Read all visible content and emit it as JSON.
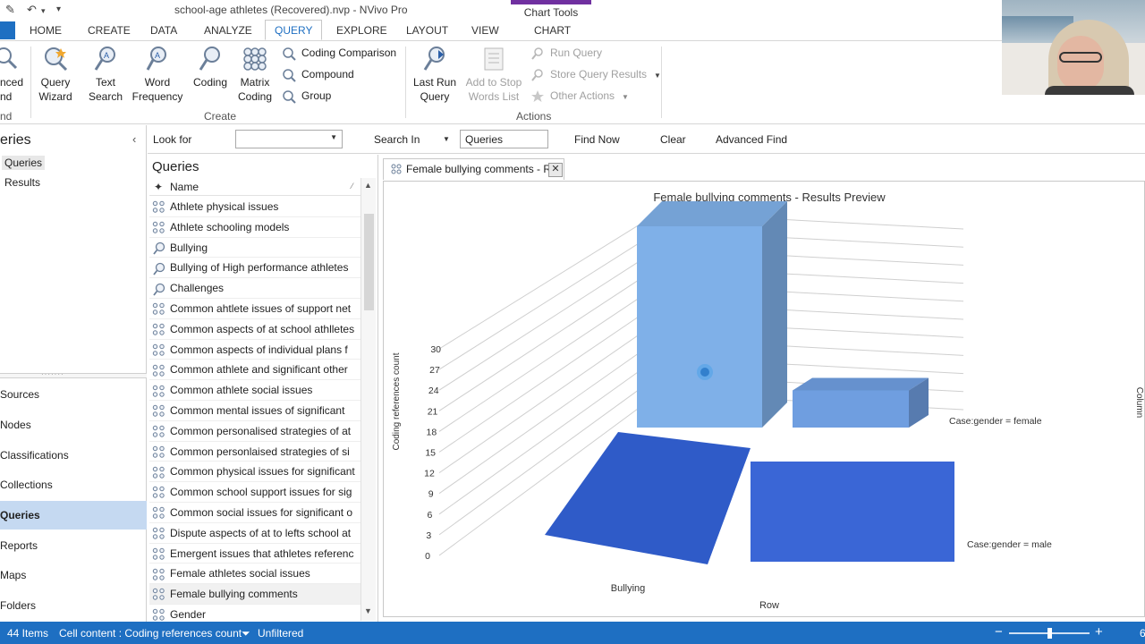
{
  "title_bar": {
    "document_title": "school-age athletes (Recovered).nvp - NVivo Pro",
    "contextual_group": "Chart Tools"
  },
  "ribbon_tabs": [
    "HOME",
    "CREATE",
    "DATA",
    "ANALYZE",
    "QUERY",
    "EXPLORE",
    "LAYOUT",
    "VIEW",
    "CHART"
  ],
  "active_tab": "QUERY",
  "ribbon": {
    "partial_left": {
      "line1": "nced",
      "line2": "nd",
      "group": "nd"
    },
    "create_buttons": {
      "query_wizard": [
        "Query",
        "Wizard"
      ],
      "text_search": [
        "Text",
        "Search"
      ],
      "word_frequency": [
        "Word",
        "Frequency"
      ],
      "coding": [
        "Coding",
        ""
      ],
      "matrix_coding": [
        "Matrix",
        "Coding"
      ]
    },
    "create_small": [
      "Coding Comparison",
      "Compound",
      "Group"
    ],
    "create_group_label": "Create",
    "actions_buttons": {
      "last_run_query": [
        "Last Run",
        "Query"
      ],
      "add_to_stop_words": [
        "Add to Stop",
        "Words List"
      ]
    },
    "actions_small": [
      "Run Query",
      "Store Query Results",
      "Other Actions"
    ],
    "actions_group_label": "Actions"
  },
  "left_nav": {
    "title": "eries",
    "tree": [
      "Queries",
      "Results"
    ],
    "buttons": [
      "Sources",
      "Nodes",
      "Classifications",
      "Collections",
      "Queries",
      "Reports",
      "Maps",
      "Folders"
    ],
    "selected_button": "Queries"
  },
  "find_bar": {
    "look_for_label": "Look for",
    "look_for_value": "",
    "search_in_label": "Search In",
    "search_in_value": "Queries",
    "find_now": "Find Now",
    "clear": "Clear",
    "advanced_find": "Advanced Find"
  },
  "query_list": {
    "title": "Queries",
    "column_name": "Name",
    "rows": [
      {
        "name": "Athlete physical issues",
        "icon": "matrix-query-icon"
      },
      {
        "name": "Athlete schooling models",
        "icon": "matrix-query-icon"
      },
      {
        "name": "Bullying",
        "icon": "text-search-icon"
      },
      {
        "name": "Bullying of High performance athletes",
        "icon": "text-search-icon"
      },
      {
        "name": "Challenges",
        "icon": "text-search-icon"
      },
      {
        "name": "Common ahtlete issues of support net",
        "icon": "matrix-query-icon"
      },
      {
        "name": "Common aspects of at school athlletes",
        "icon": "matrix-query-icon"
      },
      {
        "name": "Common aspects of individual plans f",
        "icon": "matrix-query-icon"
      },
      {
        "name": "Common athlete and significant other",
        "icon": "matrix-query-icon"
      },
      {
        "name": "Common athlete social issues",
        "icon": "matrix-query-icon"
      },
      {
        "name": "Common mental issues of significant",
        "icon": "matrix-query-icon"
      },
      {
        "name": "Common personalised strategies of at",
        "icon": "matrix-query-icon"
      },
      {
        "name": "Common personlaised strategies of si",
        "icon": "matrix-query-icon"
      },
      {
        "name": "Common physical issues for significant",
        "icon": "matrix-query-icon"
      },
      {
        "name": "Common school support issues for sig",
        "icon": "matrix-query-icon"
      },
      {
        "name": "Common social issues for significant o",
        "icon": "matrix-query-icon"
      },
      {
        "name": "Dispute aspects of at to lefts school at",
        "icon": "matrix-query-icon"
      },
      {
        "name": "Emergent issues that athletes referenc",
        "icon": "matrix-query-icon"
      },
      {
        "name": "Female athletes social issues",
        "icon": "matrix-query-icon"
      },
      {
        "name": "Female bullying comments",
        "icon": "matrix-query-icon",
        "selected": true
      },
      {
        "name": "Gender",
        "icon": "matrix-query-icon"
      }
    ]
  },
  "detail": {
    "tab_label": "Female bullying comments - R"
  },
  "chart_data": {
    "type": "bar",
    "subtype": "3d-column",
    "title": "Female bullying comments - Results Preview",
    "ylabel": "Coding references count",
    "yticks": [
      0,
      3,
      6,
      9,
      12,
      15,
      18,
      21,
      24,
      27,
      30
    ],
    "ylim": [
      0,
      30
    ],
    "categories": [
      "Bullying"
    ],
    "row_axis_label": "Row",
    "column_axis_label": "Column",
    "series": [
      {
        "name": "Case:gender = female",
        "values": [
          30,
          1
        ],
        "color": "#7fb0e8"
      },
      {
        "name": "Case:gender = male",
        "values": [
          0,
          12
        ],
        "color": "#2f5bc8"
      }
    ],
    "grid": true
  },
  "status_bar": {
    "items": "44 Items",
    "cell_content": "Cell content : Coding references count",
    "filter": "Unfiltered",
    "zoom_minus": "−",
    "zoom_plus": "+",
    "zoom_partial": "6"
  },
  "colors": {
    "accent": "#1e6fc2",
    "chart_tools": "#7030a0",
    "nav_selected": "#c5d9f1"
  }
}
